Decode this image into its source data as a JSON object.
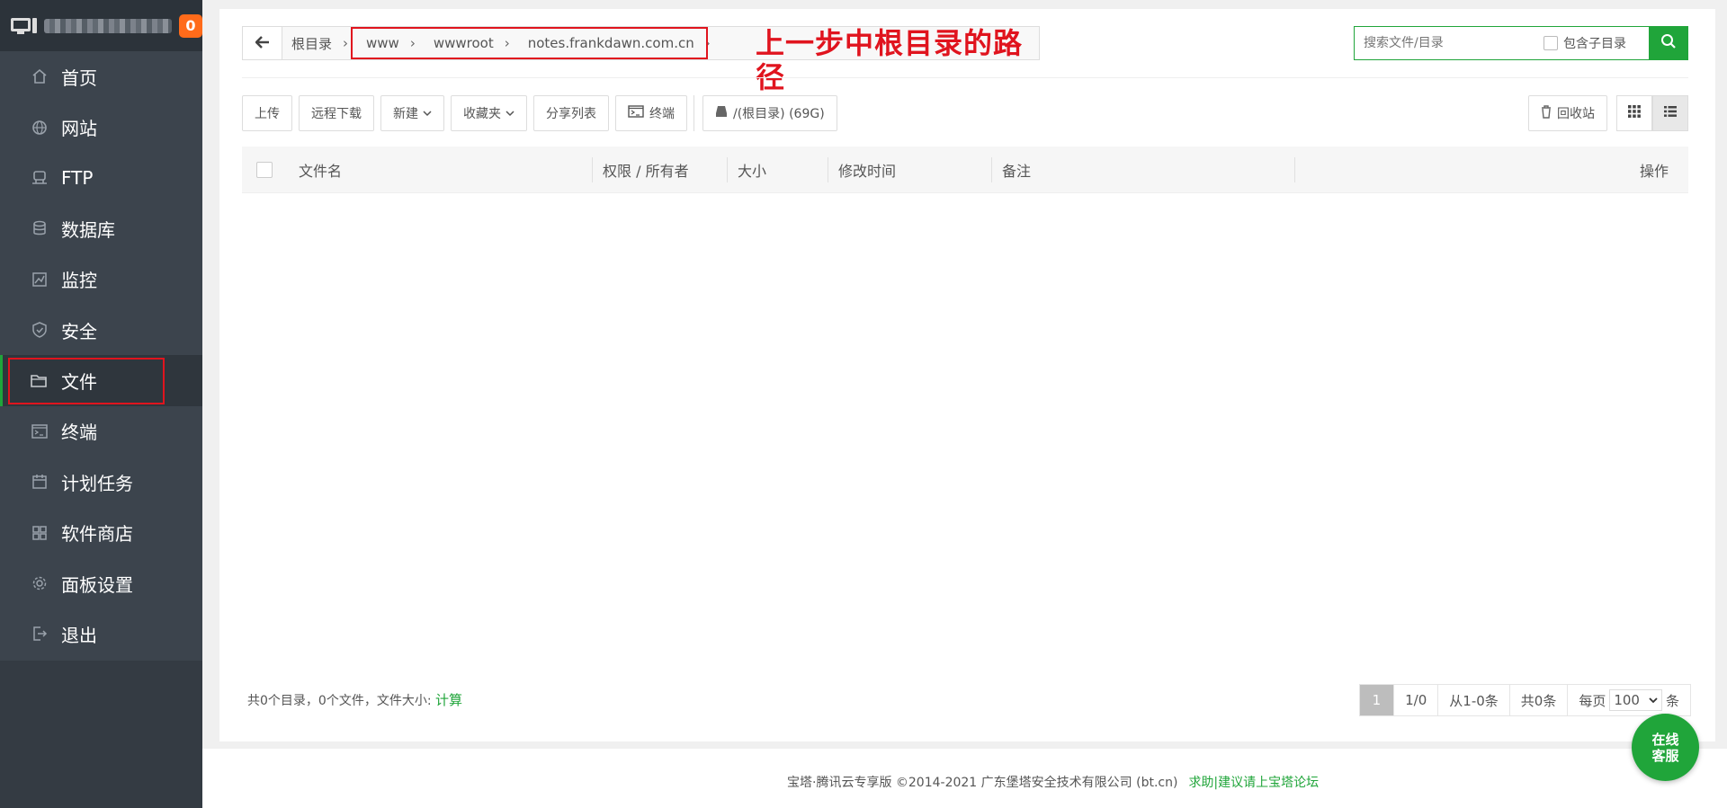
{
  "sidebar": {
    "update_badge": "0",
    "items": [
      {
        "label": "首页",
        "icon": "home-icon"
      },
      {
        "label": "网站",
        "icon": "globe-icon"
      },
      {
        "label": "FTP",
        "icon": "ftp-icon"
      },
      {
        "label": "数据库",
        "icon": "database-icon"
      },
      {
        "label": "监控",
        "icon": "monitor-chart-icon"
      },
      {
        "label": "安全",
        "icon": "shield-icon"
      },
      {
        "label": "文件",
        "icon": "folder-icon",
        "active": true
      },
      {
        "label": "终端",
        "icon": "terminal-icon"
      },
      {
        "label": "计划任务",
        "icon": "calendar-icon"
      },
      {
        "label": "软件商店",
        "icon": "apps-grid-icon"
      },
      {
        "label": "面板设置",
        "icon": "gear-icon"
      },
      {
        "label": "退出",
        "icon": "logout-icon"
      }
    ]
  },
  "breadcrumb": {
    "root": "根目录",
    "parts": [
      "www",
      "wwwroot",
      "notes.frankdawn.com.cn"
    ],
    "annotation": "上一步中根目录的路径"
  },
  "search": {
    "placeholder": "搜索文件/目录",
    "include_sub_label": "包含子目录"
  },
  "toolbar": {
    "upload": "上传",
    "remote_download": "远程下载",
    "new": "新建",
    "favorites": "收藏夹",
    "share_list": "分享列表",
    "terminal": "终端",
    "disk": "/(根目录) (69G)",
    "recycle_bin": "回收站"
  },
  "table": {
    "columns": [
      "文件名",
      "权限 / 所有者",
      "大小",
      "修改时间",
      "备注",
      "操作"
    ]
  },
  "summary": {
    "text": "共0个目录，0个文件，文件大小: ",
    "calc_link": "计算"
  },
  "pager": {
    "current_page": "1",
    "page_of": "1/0",
    "range": "从1-0条",
    "total": "共0条",
    "per_page_label": "每页",
    "per_page_value": "100",
    "per_page_unit": "条"
  },
  "footer": {
    "copyright": "宝塔·腾讯云专享版 ©2014-2021 广东堡塔安全技术有限公司 (bt.cn)",
    "help_link": "求助|建议请上宝塔论坛"
  },
  "chat": {
    "line1": "在线",
    "line2": "客服"
  },
  "colors": {
    "accent": "#20a53a",
    "highlight": "#e0141e",
    "badge": "#ff6b1a",
    "sidebar_bg": "#3c444d"
  }
}
